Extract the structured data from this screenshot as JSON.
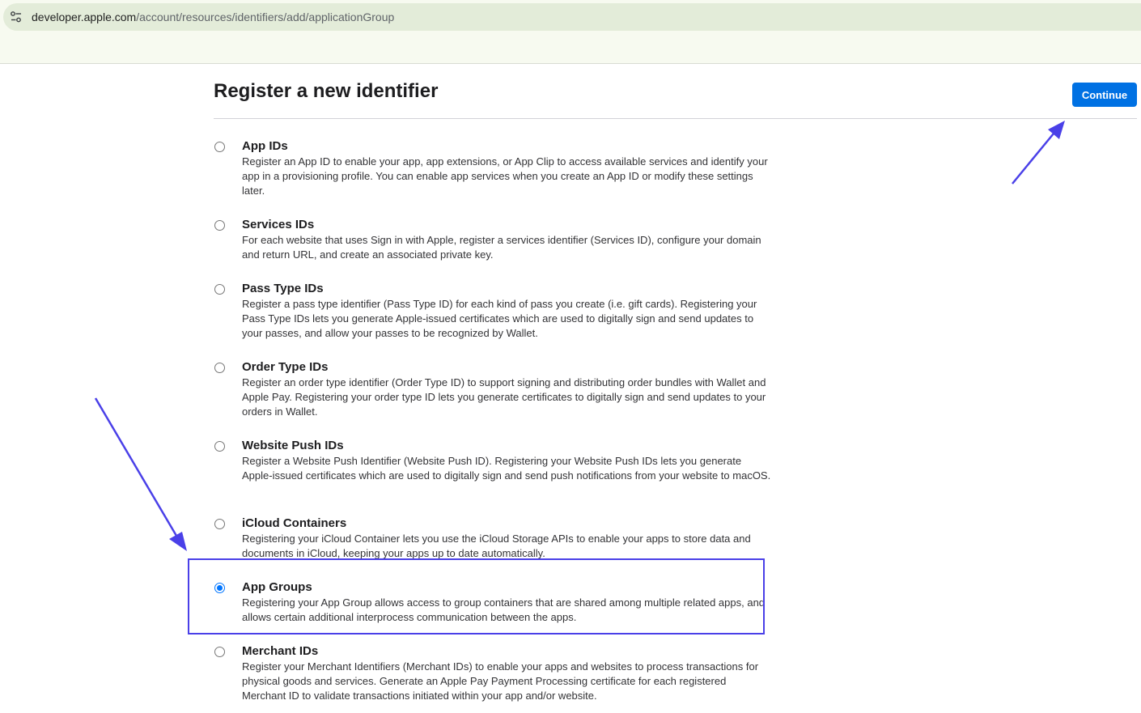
{
  "browser": {
    "url_host": "developer.apple.com",
    "url_path": "/account/resources/identifiers/add/applicationGroup",
    "site_info_icon": "tune-icon"
  },
  "page": {
    "title": "Register a new identifier",
    "continue_label": "Continue"
  },
  "options": [
    {
      "title": "App IDs",
      "description": "Register an App ID to enable your app, app extensions, or App Clip to access available services and identify your app in a provisioning profile. You can enable app services when you create an App ID or modify these settings later.",
      "selected": false
    },
    {
      "title": "Services IDs",
      "description": "For each website that uses Sign in with Apple, register a services identifier (Services ID), configure your domain and return URL, and create an associated private key.",
      "selected": false
    },
    {
      "title": "Pass Type IDs",
      "description": "Register a pass type identifier (Pass Type ID) for each kind of pass you create (i.e. gift cards). Registering your Pass Type IDs lets you generate Apple-issued certificates which are used to digitally sign and send updates to your passes, and allow your passes to be recognized by Wallet.",
      "selected": false
    },
    {
      "title": "Order Type IDs",
      "description": "Register an order type identifier (Order Type ID) to support signing and distributing order bundles with Wallet and Apple Pay. Registering your order type ID lets you generate certificates to digitally sign and send updates to your orders in Wallet.",
      "selected": false
    },
    {
      "title": "Website Push IDs",
      "description": "Register a Website Push Identifier (Website Push ID). Registering your Website Push IDs lets you generate Apple-issued certificates which are used to digitally sign and send push notifications from your website to macOS.",
      "selected": false
    },
    {
      "title": "iCloud Containers",
      "description": "Registering your iCloud Container lets you use the iCloud Storage APIs to enable your apps to store data and documents in iCloud, keeping your apps up to date automatically.",
      "selected": false
    },
    {
      "title": "App Groups",
      "description": "Registering your App Group allows access to group containers that are shared among multiple related apps, and allows certain additional interprocess communication between the apps.",
      "selected": true
    },
    {
      "title": "Merchant IDs",
      "description": "Register your Merchant Identifiers (Merchant IDs) to enable your apps and websites to process transactions for physical goods and services. Generate an Apple Pay Payment Processing certificate for each registered Merchant ID to validate transactions initiated within your app and/or website.",
      "selected": false
    }
  ],
  "annotation_color": "#4a40e8",
  "accent_color": "#0071e3"
}
